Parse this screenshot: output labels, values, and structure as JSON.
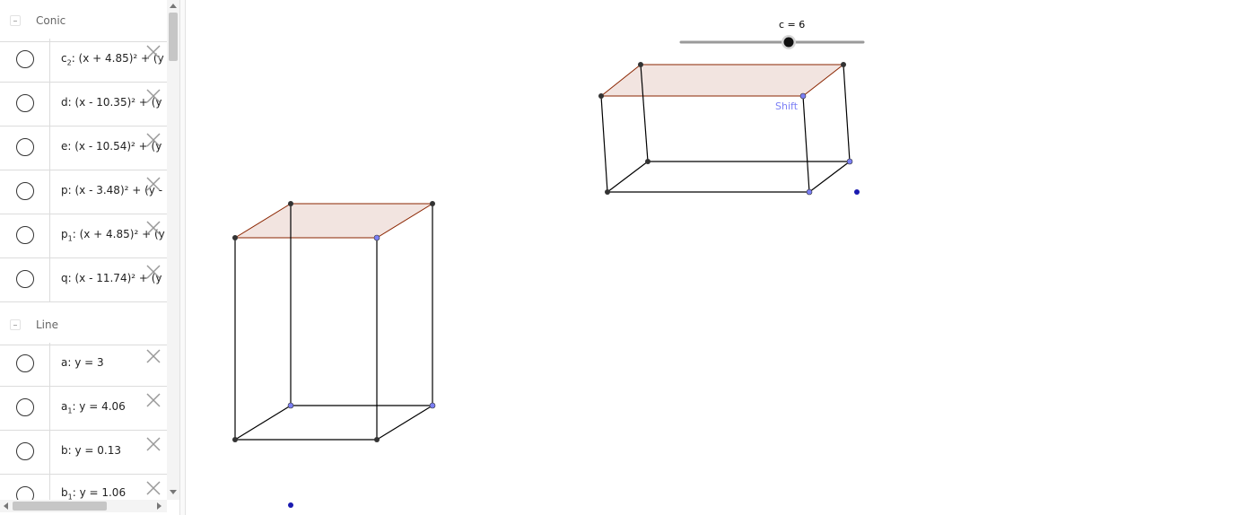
{
  "algebra": {
    "groups": [
      {
        "label": "Conic",
        "items": [
          {
            "name": "c",
            "sub": "2",
            "rest": ": (x + 4.85)² + (y"
          },
          {
            "name": "d",
            "sub": "",
            "rest": ": (x - 10.35)² + (y"
          },
          {
            "name": "e",
            "sub": "",
            "rest": ": (x - 10.54)² + (y"
          },
          {
            "name": "p",
            "sub": "",
            "rest": ": (x - 3.48)² + (y -"
          },
          {
            "name": "p",
            "sub": "1",
            "rest": ": (x + 4.85)² + (y"
          },
          {
            "name": "q",
            "sub": "",
            "rest": ": (x - 11.74)² + (y"
          }
        ]
      },
      {
        "label": "Line",
        "items": [
          {
            "name": "a",
            "sub": "",
            "rest": ": y = 3"
          },
          {
            "name": "a",
            "sub": "1",
            "rest": ": y = 4.06"
          },
          {
            "name": "b",
            "sub": "",
            "rest": ": y = 0.13"
          },
          {
            "name": "b",
            "sub": "1",
            "rest": ": y = 1.06"
          }
        ]
      }
    ]
  },
  "graphics": {
    "slider": {
      "label": "c = 6",
      "min": 0,
      "max": 10,
      "value": 6
    },
    "shift_label": "Shift",
    "colors": {
      "face_fill": "#f2e4e0",
      "face_stroke": "#8b2500",
      "edge": "#000000",
      "free_point": "#7b7ff5",
      "dark_point": "#333333",
      "blue_dot": "#1a1ab0"
    }
  }
}
